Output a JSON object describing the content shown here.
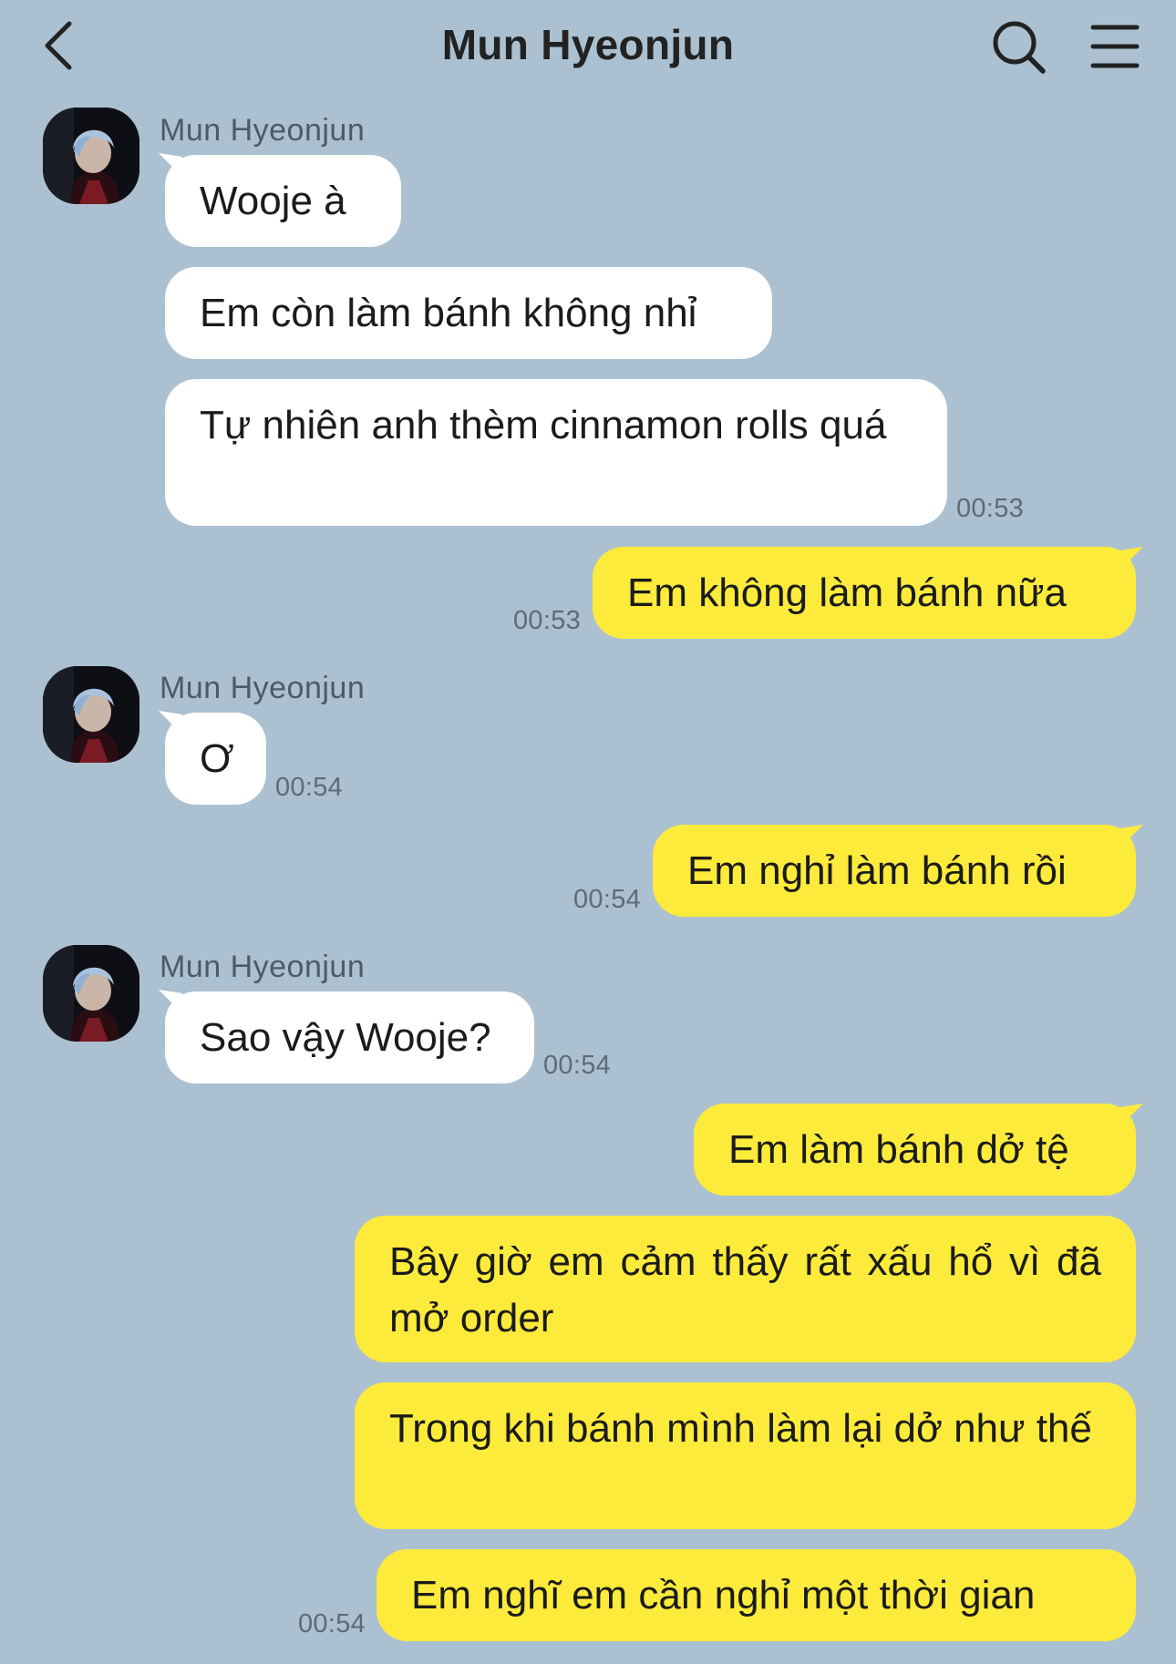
{
  "header": {
    "title": "Mun Hyeonjun",
    "back_icon": "chevron-left-icon",
    "search_icon": "search-icon",
    "menu_icon": "hamburger-menu-icon"
  },
  "colors": {
    "background": "#abc1d1",
    "incoming_bubble": "#ffffff",
    "outgoing_bubble": "#fdeb3b"
  },
  "messages": {
    "g1": {
      "sender": "Mun Hyeonjun",
      "m1": "Wooje à",
      "m2": "Em còn làm bánh không nhỉ",
      "m3": "Tự nhiên anh thèm cinnamon rolls quá",
      "time": "00:53"
    },
    "o1": {
      "m1": "Em không làm bánh nữa",
      "time": "00:53"
    },
    "g2": {
      "sender": "Mun Hyeonjun",
      "m1": "Ơ",
      "time": "00:54"
    },
    "o2": {
      "m1": "Em nghỉ làm bánh rồi",
      "time": "00:54"
    },
    "g3": {
      "sender": "Mun Hyeonjun",
      "m1": "Sao vậy Wooje?",
      "time": "00:54"
    },
    "o3": {
      "m1": "Em làm bánh dở tệ",
      "m2": "Bây giờ em cảm thấy rất xấu hổ vì đã mở order",
      "m3": "Trong khi bánh mình làm lại dở như thế",
      "m4": "Em nghĩ em cần nghỉ một thời gian",
      "time": "00:54"
    }
  }
}
